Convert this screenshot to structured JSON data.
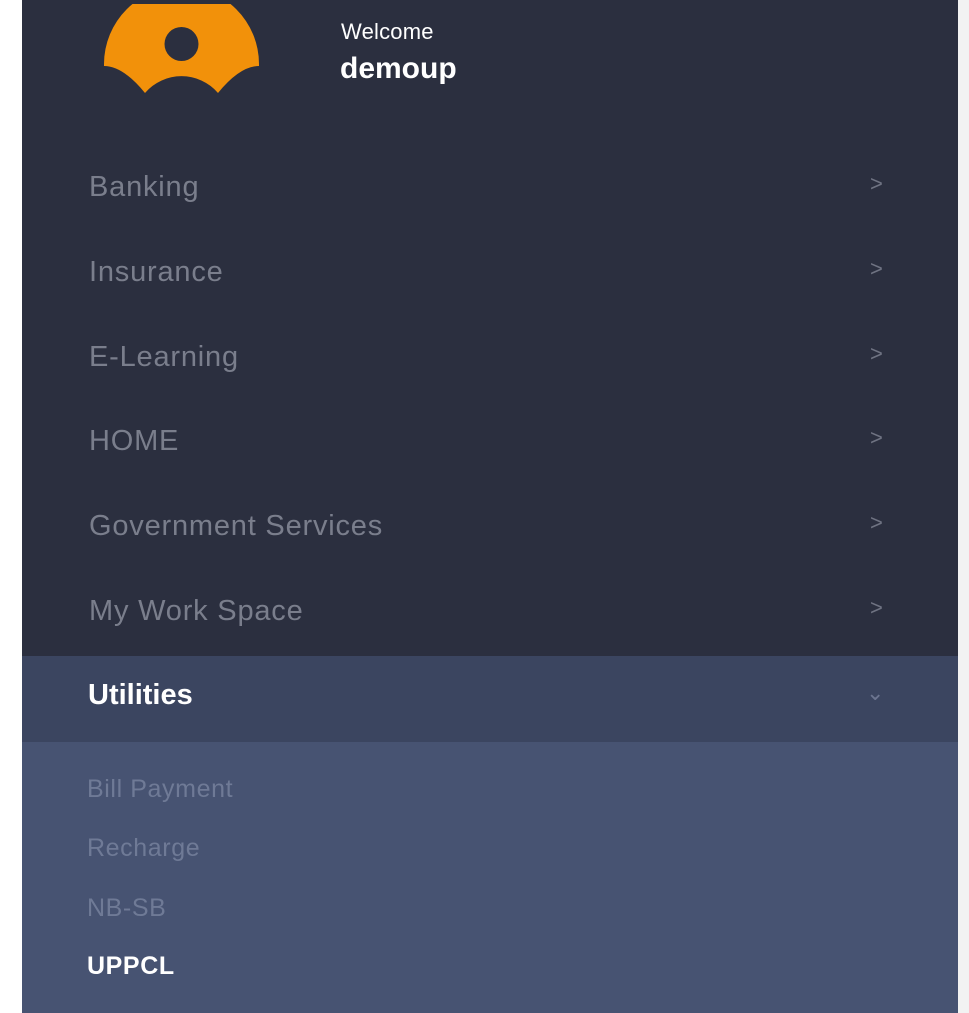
{
  "profile": {
    "greeting": "Welcome",
    "username": "demoup",
    "avatar_color": "#f2910a"
  },
  "menu": [
    {
      "label": "Banking",
      "chevron": ">"
    },
    {
      "label": "Insurance",
      "chevron": ">"
    },
    {
      "label": "E-Learning",
      "chevron": ">"
    },
    {
      "label": "HOME",
      "chevron": ">"
    },
    {
      "label": "Government Services",
      "chevron": ">"
    },
    {
      "label": "My Work Space",
      "chevron": ">"
    }
  ],
  "utilities": {
    "label": "Utilities",
    "chevron": "⌄",
    "expanded": true,
    "items": [
      {
        "label": "Bill Payment",
        "active": false
      },
      {
        "label": "Recharge",
        "active": false
      },
      {
        "label": "NB-SB",
        "active": false
      },
      {
        "label": "UPPCL",
        "active": true
      }
    ]
  },
  "colors": {
    "sidebar_bg": "#2b2f3f",
    "active_header_bg": "#3b4560",
    "submenu_bg": "#475372",
    "muted_text": "#7a7e8c",
    "active_text": "#ffffff"
  }
}
